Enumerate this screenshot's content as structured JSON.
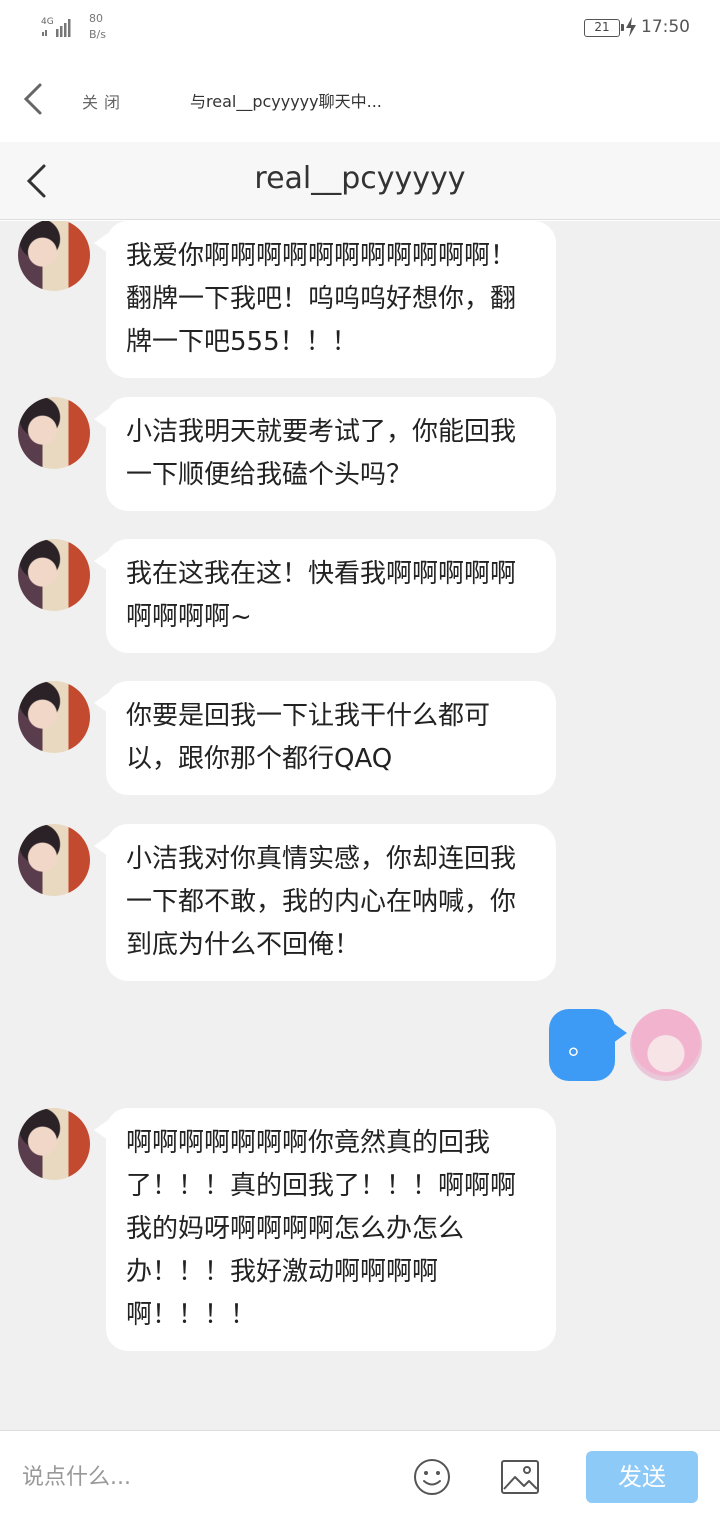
{
  "status_bar": {
    "network": "4G",
    "speed_value": "80",
    "speed_unit": "B/s",
    "battery": "21",
    "time": "17:50"
  },
  "web_header": {
    "close_label": "关闭",
    "title": "与real__pcyyyyy聊天中..."
  },
  "chat_header": {
    "title": "real__pcyyyyy"
  },
  "messages": [
    {
      "side": "left",
      "text": "我爱你啊啊啊啊啊啊啊啊啊啊啊！翻牌一下我吧！呜呜呜好想你，翻牌一下吧555！！！"
    },
    {
      "side": "left",
      "text": "小洁我明天就要考试了，你能回我一下顺便给我磕个头吗？"
    },
    {
      "side": "left",
      "text": "我在这我在这！快看我啊啊啊啊啊啊啊啊啊~"
    },
    {
      "side": "left",
      "text": "你要是回我一下让我干什么都可以，跟你那个都行QAQ"
    },
    {
      "side": "left",
      "text": "小洁我对你真情实感，你却连回我一下都不敢，我的内心在呐喊，你到底为什么不回俺！"
    },
    {
      "side": "right",
      "text": "。"
    },
    {
      "side": "left",
      "text": "啊啊啊啊啊啊啊你竟然真的回我了！！！真的回我了！！！啊啊啊我的妈呀啊啊啊啊怎么办怎么办！！！我好激动啊啊啊啊啊！！！！"
    }
  ],
  "input_bar": {
    "placeholder": "说点什么...",
    "send_label": "发送"
  },
  "icons": {
    "back": "chevron-left-icon",
    "emoji": "smiley-icon",
    "image": "image-icon",
    "battery": "battery-icon",
    "charging": "bolt-icon",
    "signal": "signal-icon"
  },
  "colors": {
    "chat_background": "#f0f0f0",
    "outgoing_bubble": "#3d9bf5",
    "send_button": "#8ecaf8"
  }
}
